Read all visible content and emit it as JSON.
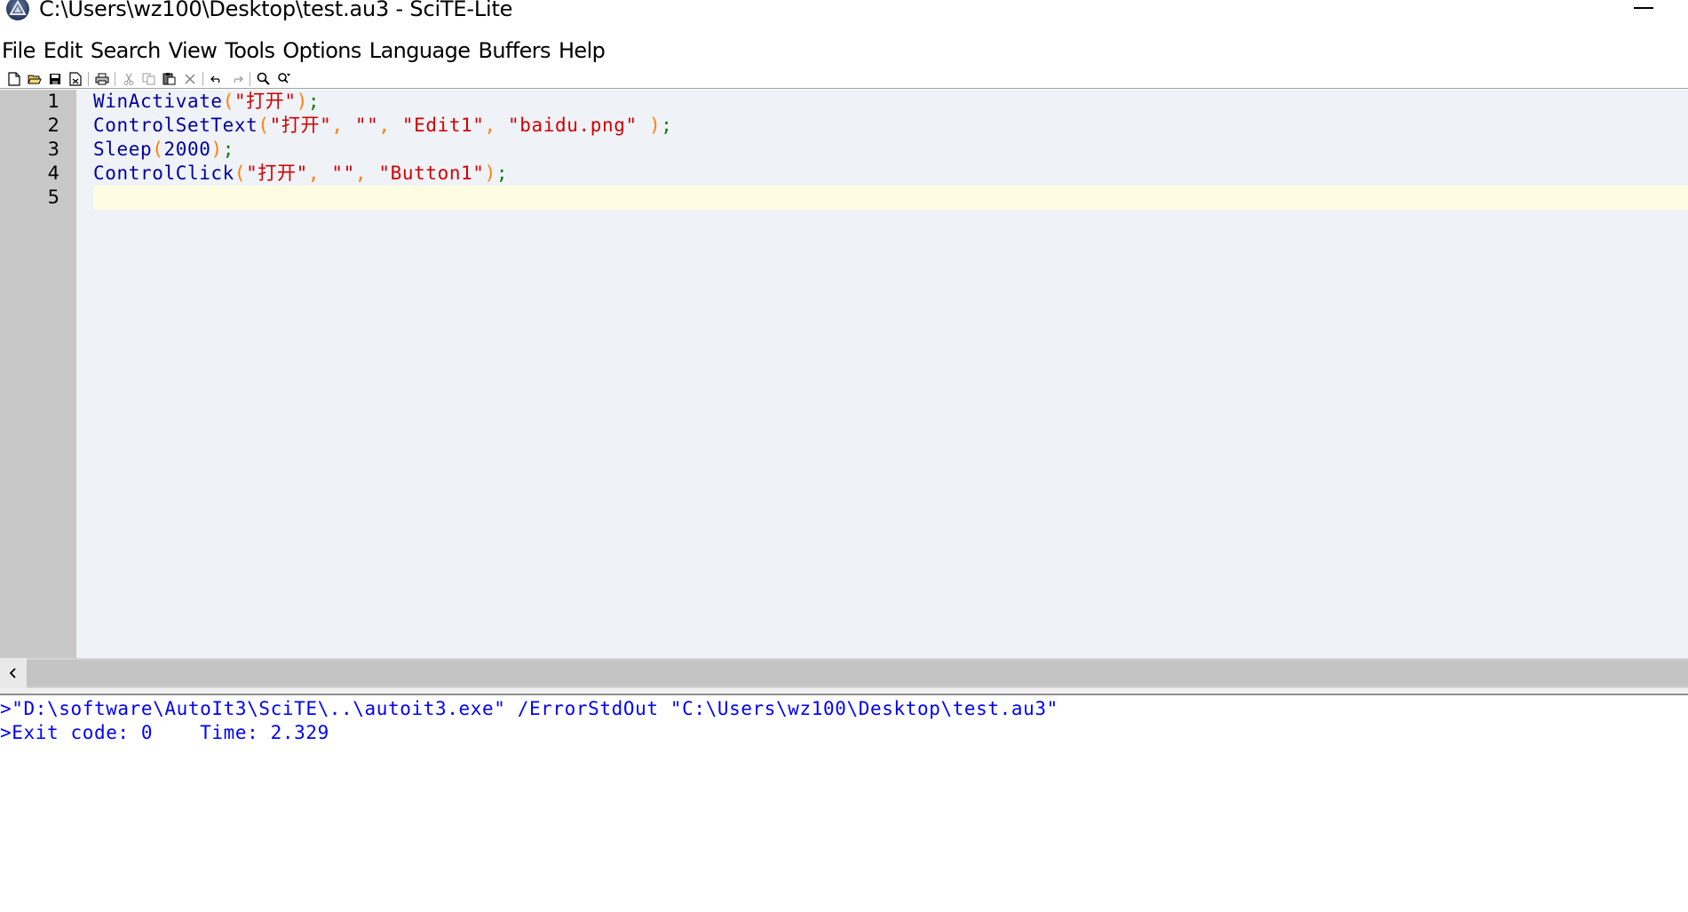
{
  "window": {
    "title": "C:\\Users\\wz100\\Desktop\\test.au3 - SciTE-Lite"
  },
  "menu": [
    "File",
    "Edit",
    "Search",
    "View",
    "Tools",
    "Options",
    "Language",
    "Buffers",
    "Help"
  ],
  "toolbar": {
    "groups": [
      [
        "new-file-icon",
        "open-folder-icon",
        "save-icon",
        "close-file-icon"
      ],
      [
        "print-icon"
      ],
      [
        "cut-icon",
        "copy-icon",
        "paste-icon",
        "delete-icon"
      ],
      [
        "undo-icon",
        "redo-icon"
      ],
      [
        "find-icon",
        "replace-icon"
      ]
    ]
  },
  "editor": {
    "line_numbers": [
      "1",
      "2",
      "3",
      "4",
      "5"
    ],
    "lines": [
      [
        {
          "t": "WinActivate",
          "k": "fn"
        },
        {
          "t": "(",
          "k": "paren"
        },
        {
          "t": "\"打开\"",
          "k": "str"
        },
        {
          "t": ")",
          "k": "paren"
        },
        {
          "t": ";",
          "k": "semi"
        }
      ],
      [
        {
          "t": "ControlSetText",
          "k": "fn"
        },
        {
          "t": "(",
          "k": "paren"
        },
        {
          "t": "\"打开\"",
          "k": "str"
        },
        {
          "t": ", ",
          "k": "paren"
        },
        {
          "t": "\"\"",
          "k": "str"
        },
        {
          "t": ", ",
          "k": "paren"
        },
        {
          "t": "\"Edit1\"",
          "k": "str"
        },
        {
          "t": ", ",
          "k": "paren"
        },
        {
          "t": "\"baidu.png\"",
          "k": "str"
        },
        {
          "t": " )",
          "k": "paren"
        },
        {
          "t": ";",
          "k": "semi"
        }
      ],
      [
        {
          "t": "Sleep",
          "k": "fn"
        },
        {
          "t": "(",
          "k": "paren"
        },
        {
          "t": "2000",
          "k": "num"
        },
        {
          "t": ")",
          "k": "paren"
        },
        {
          "t": ";",
          "k": "semi"
        }
      ],
      [
        {
          "t": "ControlClick",
          "k": "fn"
        },
        {
          "t": "(",
          "k": "paren"
        },
        {
          "t": "\"打开\"",
          "k": "str"
        },
        {
          "t": ", ",
          "k": "paren"
        },
        {
          "t": "\"\"",
          "k": "str"
        },
        {
          "t": ", ",
          "k": "paren"
        },
        {
          "t": "\"Button1\"",
          "k": "str"
        },
        {
          "t": ")",
          "k": "paren"
        },
        {
          "t": ";",
          "k": "semi"
        }
      ],
      []
    ],
    "current_line": 5
  },
  "output": {
    "lines": [
      ">\"D:\\software\\AutoIt3\\SciTE\\..\\autoit3.exe\" /ErrorStdOut \"C:\\Users\\wz100\\Desktop\\test.au3\"",
      ">Exit code: 0    Time: 2.329"
    ]
  },
  "colors": {
    "function": "#0000a0",
    "string": "#d20000",
    "number": "#0000a0",
    "operator": "#ff8000",
    "semicolon": "#008000",
    "output_text": "#0000ff",
    "caret_line": "#fdfbe1",
    "editor_bg": "#eff2f7",
    "gutter_bg": "#c8c8c8"
  }
}
